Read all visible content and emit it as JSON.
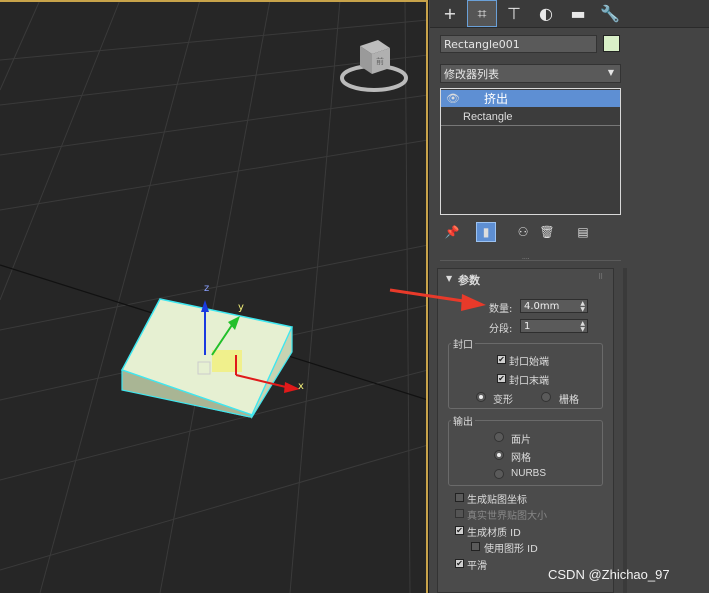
{
  "panel": {
    "tabs": [
      {
        "icon": "plus-icon",
        "glyph": "+"
      },
      {
        "icon": "modify-icon",
        "glyph": "⌗"
      },
      {
        "icon": "hierarchy-icon",
        "glyph": "⊤"
      },
      {
        "icon": "motion-icon",
        "glyph": "◐"
      },
      {
        "icon": "display-icon",
        "glyph": "▬"
      },
      {
        "icon": "utilities-icon",
        "glyph": "🔧"
      }
    ],
    "object_name": "Rectangle001",
    "object_color": "#d9f0c8",
    "modifier_list_label": "修改器列表",
    "modifier_stack": [
      {
        "label": "挤出",
        "selected": true
      },
      {
        "label": "Rectangle",
        "selected": false
      }
    ]
  },
  "params": {
    "title": "参数",
    "amount_label": "数量:",
    "amount_value": "4.0mm",
    "segments_label": "分段:",
    "segments_value": "1",
    "capping": {
      "title": "封口",
      "cap_start": "封口始端",
      "cap_start_checked": true,
      "cap_end": "封口末端",
      "cap_end_checked": true,
      "morph": "变形",
      "grid": "栅格",
      "selected": "morph"
    },
    "output": {
      "title": "输出",
      "patch": "面片",
      "mesh": "网格",
      "nurbs": "NURBS",
      "selected": "mesh"
    },
    "gen_mapping": "生成贴图坐标",
    "gen_mapping_checked": false,
    "real_world": "真实世界贴图大小",
    "real_world_checked": false,
    "gen_mat_id": "生成材质 ID",
    "gen_mat_id_checked": true,
    "use_shape_id": "使用图形 ID",
    "use_shape_id_checked": false,
    "smooth": "平滑",
    "smooth_checked": true
  },
  "viewport": {
    "axis_x": "x",
    "axis_y": "y",
    "axis_z": "z",
    "viewcube_label": "前"
  },
  "watermark": "CSDN @Zhichao_97"
}
